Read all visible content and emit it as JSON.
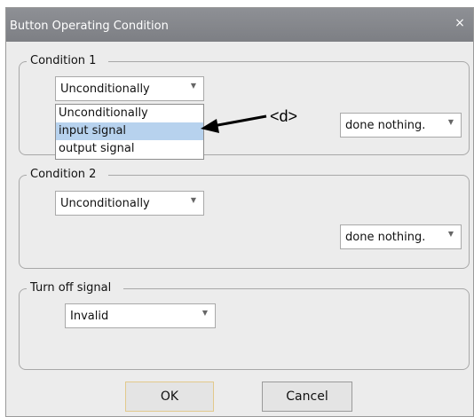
{
  "dialog": {
    "title": "Button Operating Condition",
    "close_glyph": "×"
  },
  "condition1": {
    "legend": "Condition 1",
    "condition_select": {
      "value": "Unconditionally",
      "arrow_glyph": "▼",
      "expanded": true,
      "options": [
        "Unconditionally",
        "input signal",
        "output signal"
      ],
      "highlighted_option": "input signal"
    },
    "action_select": {
      "value": "done nothing.",
      "arrow_glyph": "▼"
    }
  },
  "condition2": {
    "legend": "Condition 2",
    "condition_select": {
      "value": "Unconditionally",
      "arrow_glyph": "▼"
    },
    "action_select": {
      "value": "done nothing.",
      "arrow_glyph": "▼"
    }
  },
  "turn_off_signal": {
    "legend": "Turn off signal",
    "select": {
      "value": "Invalid",
      "arrow_glyph": "▼"
    }
  },
  "buttons": {
    "ok_label": "OK",
    "cancel_label": "Cancel"
  },
  "annotation": {
    "label": "<d>"
  },
  "colors": {
    "titlebar": "#8e9095",
    "dialog_bg": "#ececec",
    "selected_option_bg": "#b7d2ee",
    "ok_border": "#e2c98c"
  },
  "icons": {
    "close": "close-icon",
    "dropdown": "chevron-down-icon",
    "annotation_arrow": "arrow-left-icon"
  }
}
